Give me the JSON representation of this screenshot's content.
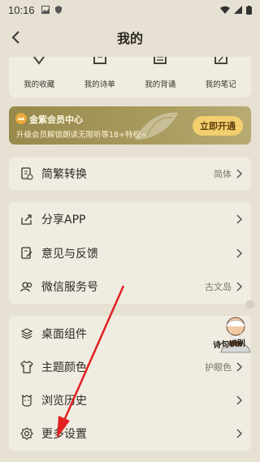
{
  "status": {
    "time": "10:16"
  },
  "nav": {
    "title": "我的"
  },
  "quick": [
    {
      "label": "我的收藏",
      "icon": "heart-icon"
    },
    {
      "label": "我的诗单",
      "icon": "book-list-icon"
    },
    {
      "label": "我的背诵",
      "icon": "recite-icon"
    },
    {
      "label": "我的笔记",
      "icon": "note-icon"
    }
  ],
  "vip": {
    "title": "金紫会员中心",
    "subtitle": "升级会员解锁朗读无限听等18+特权~",
    "button": "立即开通"
  },
  "section1": [
    {
      "label": "简繁转换",
      "value": "简体",
      "icon": "convert-icon"
    }
  ],
  "section2": [
    {
      "label": "分享APP",
      "value": "",
      "icon": "share-icon"
    },
    {
      "label": "意见与反馈",
      "value": "",
      "icon": "feedback-icon"
    },
    {
      "label": "微信服务号",
      "value": "古文岛",
      "icon": "wechat-service-icon"
    }
  ],
  "section3": [
    {
      "label": "桌面组件",
      "value": "",
      "icon": "widget-icon"
    },
    {
      "label": "主题颜色",
      "value": "护眼色",
      "icon": "theme-icon"
    },
    {
      "label": "浏览历史",
      "value": "",
      "icon": "history-icon"
    },
    {
      "label": "更多设置",
      "value": "",
      "icon": "settings-icon"
    }
  ],
  "avatar_caption": "诗句识别",
  "colors": {
    "background": "#e6e1d3",
    "card": "#f0ece2",
    "vip_gradient_start": "#97894c",
    "vip_button": "#f4cf6f",
    "arrow": "#e02020"
  }
}
